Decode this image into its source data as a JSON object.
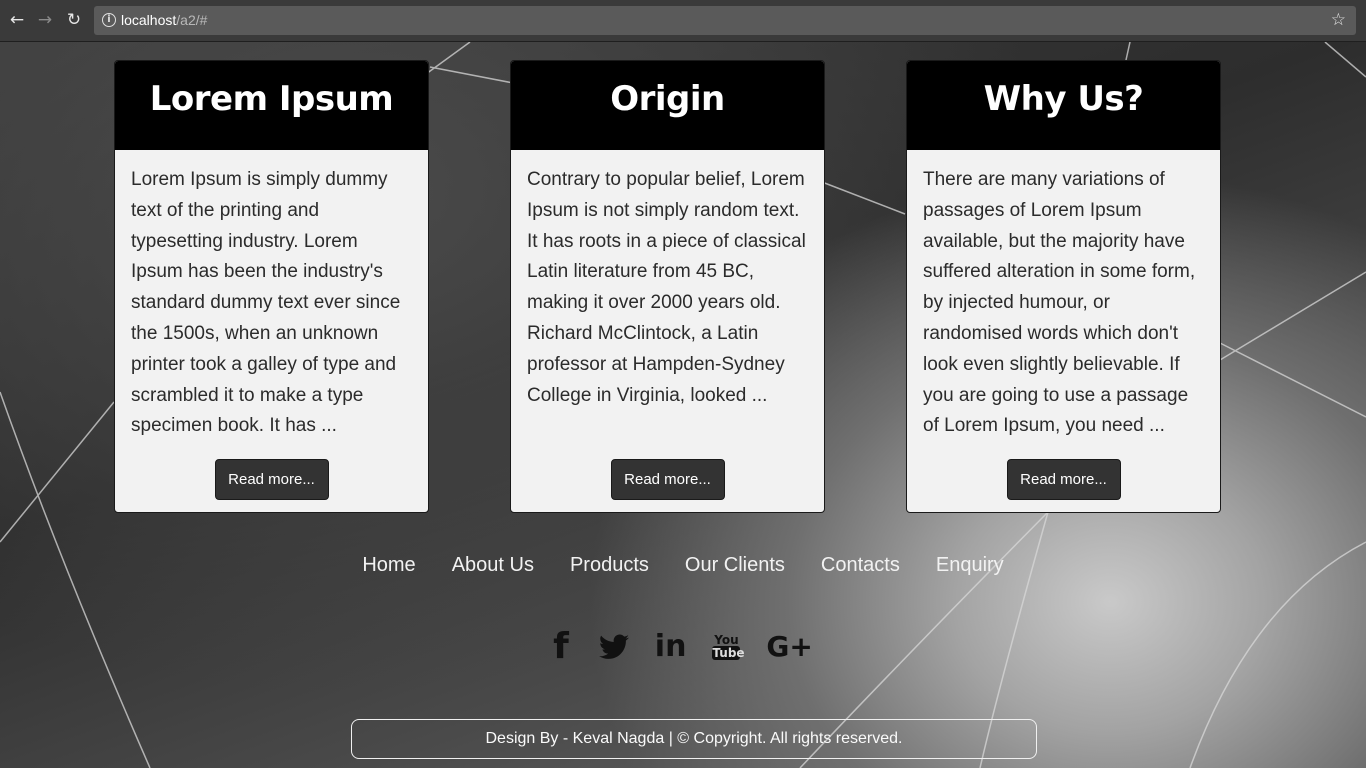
{
  "browser": {
    "back_icon": "arrow-left-icon",
    "forward_icon": "arrow-right-icon",
    "reload_icon": "reload-icon",
    "info_icon": "info-icon",
    "url_host": "localhost",
    "url_path": "/a2/#",
    "star_icon": "star-icon"
  },
  "cards": [
    {
      "title": "Lorem Ipsum",
      "text": "Lorem Ipsum is simply dummy text of the printing and typesetting industry. Lorem Ipsum has been the industry's standard dummy text ever since the 1500s, when an unknown printer took a galley of type and scrambled it to make a type specimen book. It has ...",
      "button": "Read more..."
    },
    {
      "title": "Origin",
      "text": "Contrary to popular belief, Lorem Ipsum is not simply random text. It has roots in a piece of classical Latin literature from 45 BC, making it over 2000 years old. Richard McClintock, a Latin professor at Hampden-Sydney College in Virginia, looked ...",
      "button": "Read more..."
    },
    {
      "title": "Why Us?",
      "text": "There are many variations of passages of Lorem Ipsum available, but the majority have suffered alteration in some form, by injected humour, or randomised words which don't look even slightly believable. If you are going to use a passage of Lorem Ipsum, you need ...",
      "button": "Read more..."
    }
  ],
  "footer_nav": [
    "Home",
    "About Us",
    "Products",
    "Our Clients",
    "Contacts",
    "Enquiry"
  ],
  "social": {
    "facebook": "f",
    "linkedin": "in",
    "youtube_top": "You",
    "youtube_bottom": "Tube",
    "googleplus": "G+"
  },
  "copyright": "Design By - Keval Nagda | © Copyright. All rights reserved.",
  "colors": {
    "card_header": "#000000",
    "card_body": "#f2f2f2",
    "button": "#333333"
  }
}
